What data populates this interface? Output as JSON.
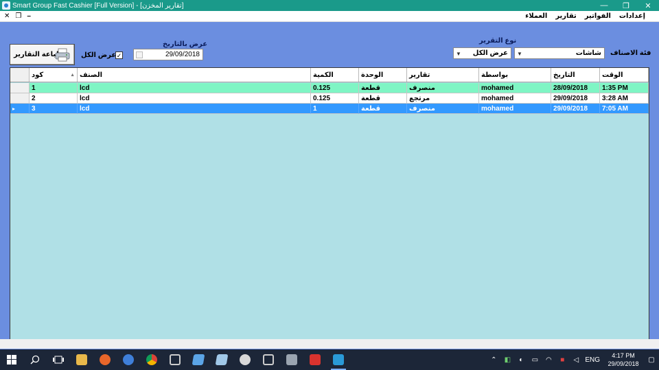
{
  "window": {
    "title": "Smart Group Fast Cashier  [Full Version] - [تقارير المخزن]",
    "minimize": "—",
    "restore": "❐",
    "close": "✕"
  },
  "menu": {
    "mdi_close": "✕",
    "mdi_restore": "❐",
    "mdi_minimize": "–",
    "items": [
      "إعدادات",
      "الفواتير",
      "تقارير",
      "العملاء"
    ]
  },
  "filters": {
    "report_type_label": "نوع التقرير",
    "category_label": "فئة الاصناف",
    "category_value": "شاشات",
    "report_type_value": "عرض الكل",
    "date_label": "عرض بالتاريخ",
    "date_value": "29/09/2018",
    "show_all_label": "عرض الكل",
    "show_all_checked": "✓",
    "print_button": "طباعة التقارير"
  },
  "grid": {
    "columns": [
      "كود",
      "الصنف",
      "الكمية",
      "الوحدة",
      "تقارير",
      "بواسطة",
      "التاريخ",
      "الوقت"
    ],
    "rows": [
      {
        "code": "1",
        "item": "lcd",
        "qty": "0.125",
        "unit": "قطعة",
        "report": "منصرف",
        "by": "mohamed",
        "date": "28/09/2018",
        "time": "1:35 PM"
      },
      {
        "code": "2",
        "item": "lcd",
        "qty": "0.125",
        "unit": "قطعة",
        "report": "مرتجع",
        "by": "mohamed",
        "date": "29/09/2018",
        "time": "3:28 AM"
      },
      {
        "code": "3",
        "item": "lcd",
        "qty": "1",
        "unit": "قطعة",
        "report": "منصرف",
        "by": "mohamed",
        "date": "29/09/2018",
        "time": "7:05 AM"
      }
    ],
    "selected_marker": "▸"
  },
  "taskbar": {
    "language": "ENG",
    "time": "4:17 PM",
    "date": "29/09/2018"
  },
  "colors": {
    "background": "#6b8ee0",
    "grid_bg": "#b0e0e6",
    "row_green": "#7ff5c4",
    "row_selected": "#3399ff",
    "titlebar": "#1a9a8a"
  }
}
